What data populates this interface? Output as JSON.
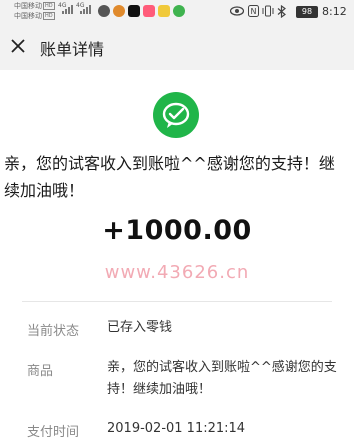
{
  "status_bar": {
    "carrier_1": "中国移动",
    "carrier_2": "中国移动",
    "badge": "HD",
    "network_1": "4G",
    "network_2": "4G",
    "battery": "98",
    "time": "8:12"
  },
  "header": {
    "title": "账单详情"
  },
  "main": {
    "message": "亲，您的试客收入到账啦^^感谢您的支持！继续加油哦！",
    "amount": "+1000.00",
    "watermark": "www.43626.cn"
  },
  "details": {
    "status_label": "当前状态",
    "status_value": "已存入零钱",
    "goods_label": "商品",
    "goods_value": "亲，您的试客收入到账啦^^感谢您的支持！继续加油哦！",
    "time_label": "支付时间",
    "time_value": "2019-02-01 11:21:14"
  },
  "colors": {
    "wechat_green": "#20b549",
    "watermark_pink": "#f2aab4"
  }
}
